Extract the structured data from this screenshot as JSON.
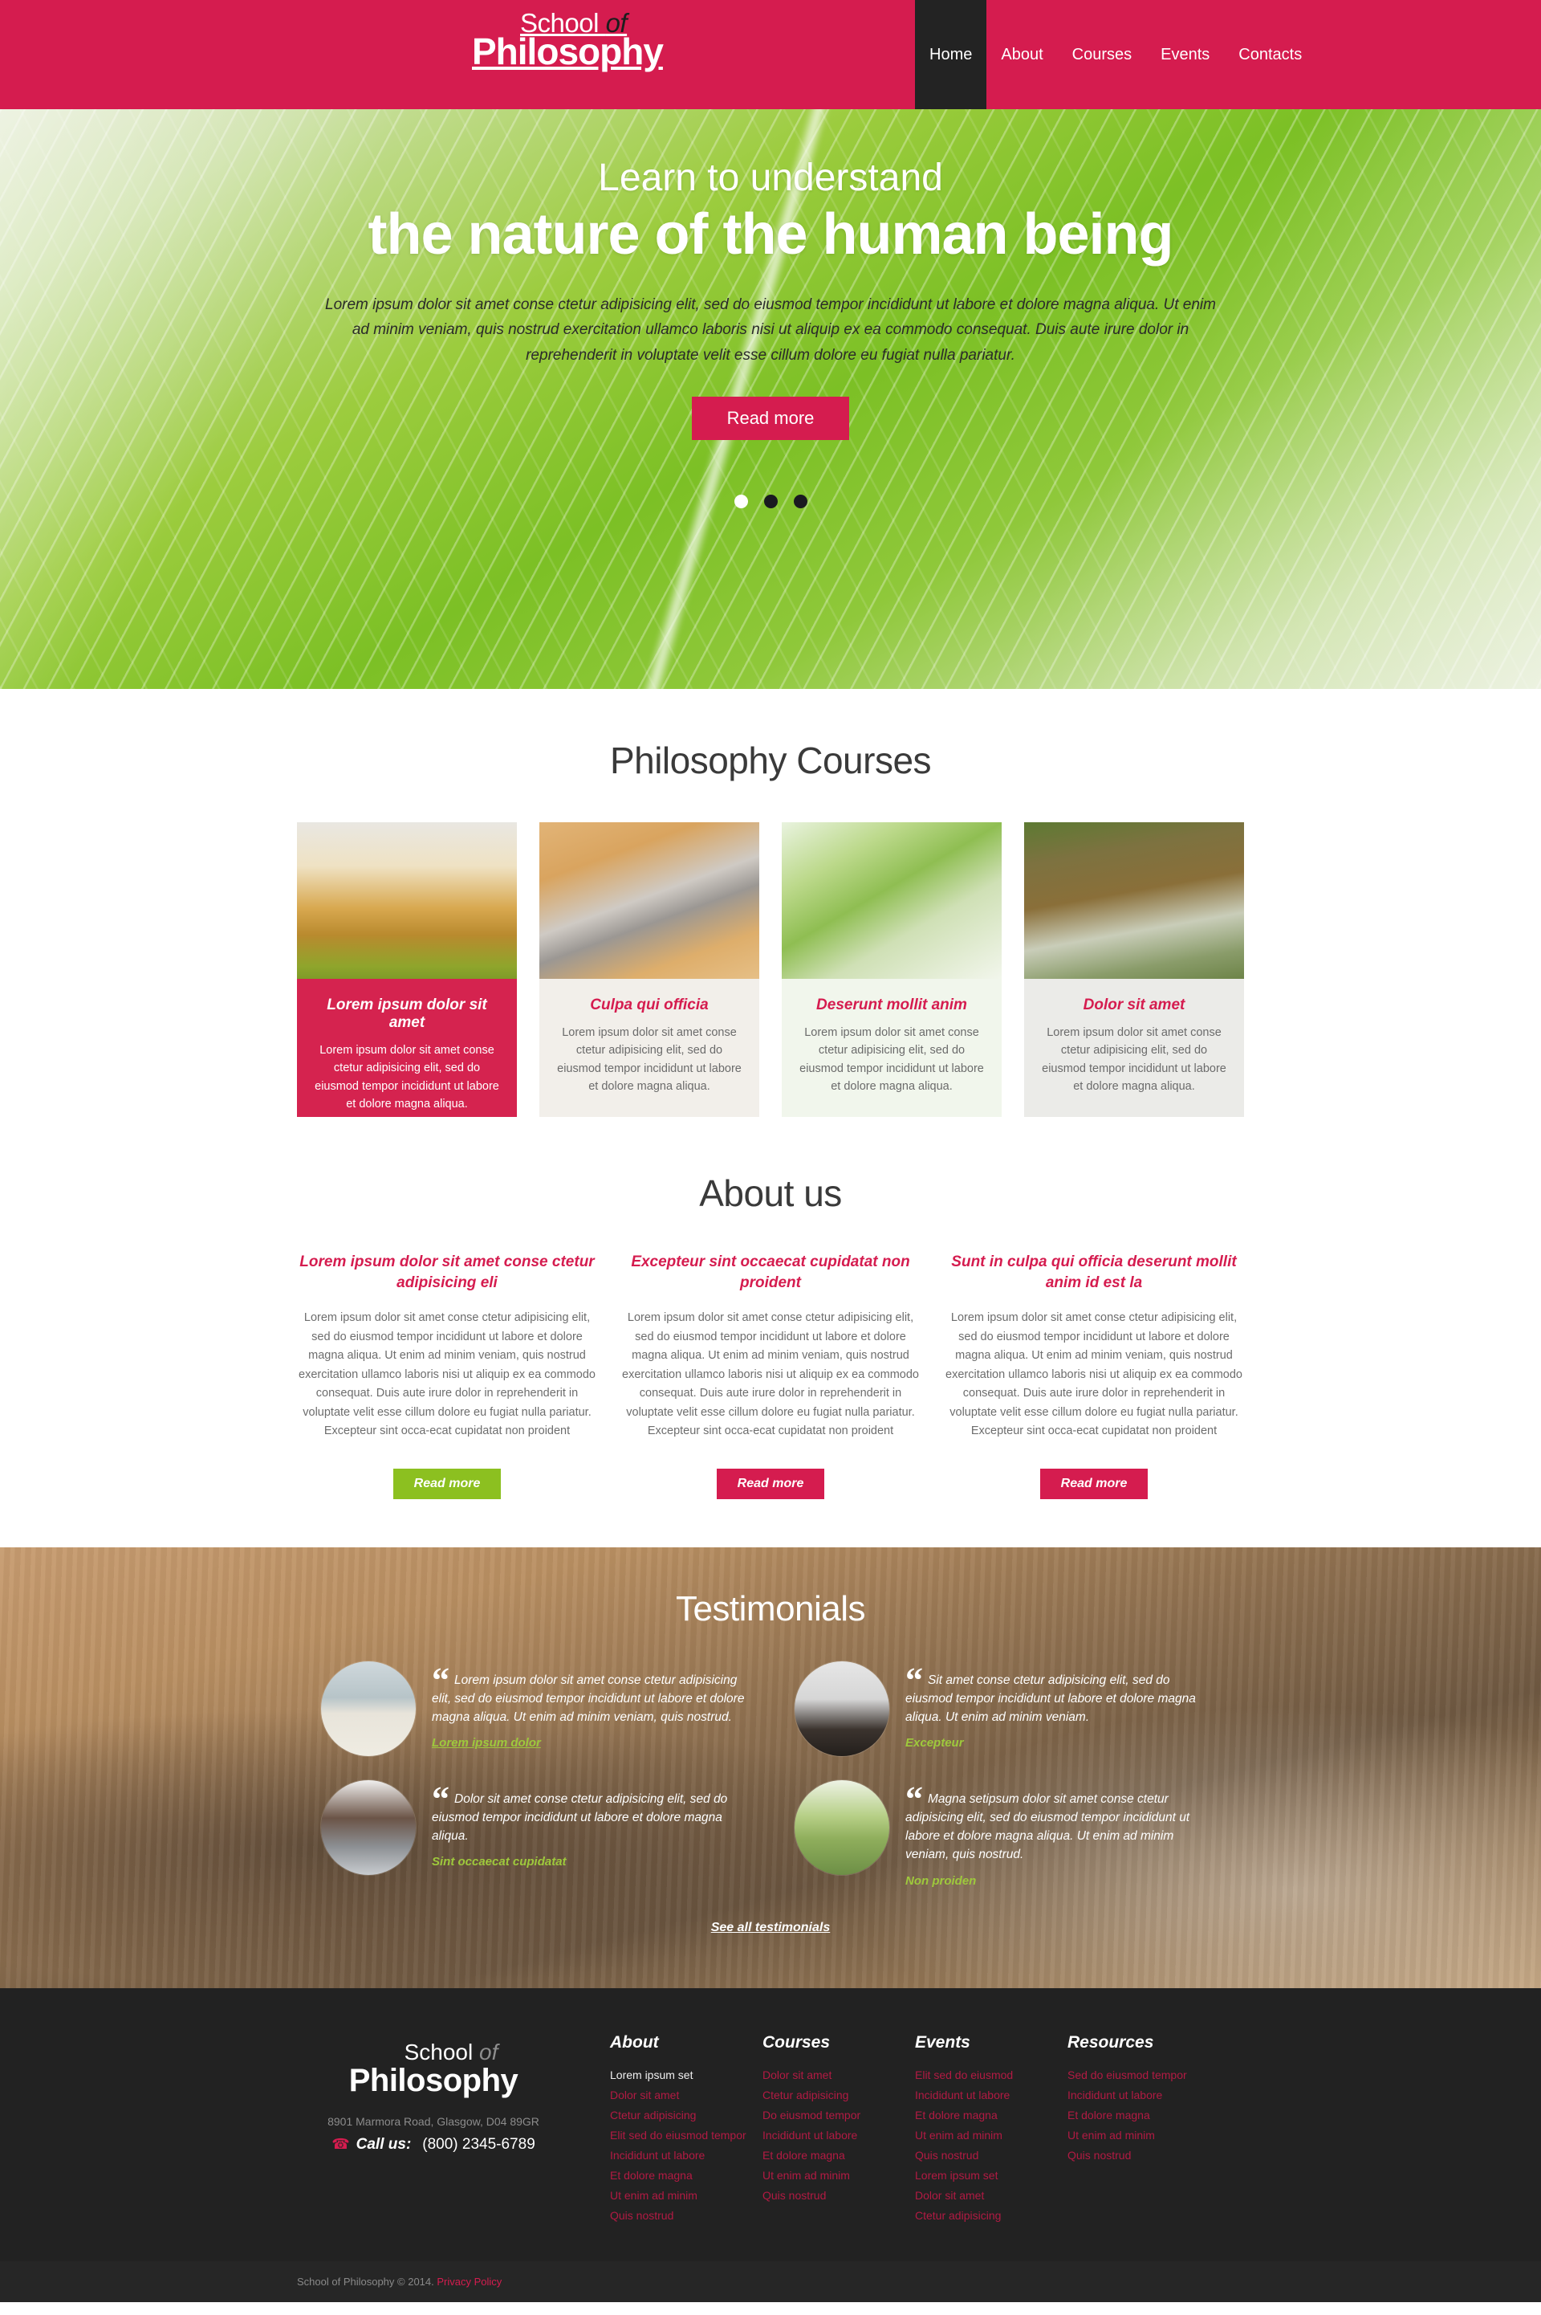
{
  "header": {
    "logo": {
      "line1_pre": "School ",
      "line1_em": "of",
      "line2": "Philosophy"
    },
    "nav": [
      {
        "label": "Home",
        "active": true
      },
      {
        "label": "About",
        "active": false
      },
      {
        "label": "Courses",
        "active": false
      },
      {
        "label": "Events",
        "active": false
      },
      {
        "label": "Contacts",
        "active": false
      }
    ]
  },
  "hero": {
    "kicker": "Learn to understand",
    "title": "the nature of the human being",
    "text": "Lorem ipsum dolor sit amet conse ctetur adipisicing elit, sed do eiusmod tempor incididunt ut labore et dolore magna aliqua. Ut enim ad minim veniam, quis nostrud exercitation ullamco laboris nisi ut aliquip ex ea commodo consequat. Duis aute irure dolor in reprehenderit in voluptate velit esse cillum dolore eu fugiat nulla pariatur.",
    "button": "Read more",
    "slides": [
      {
        "active": true
      },
      {
        "active": false
      },
      {
        "active": false
      }
    ]
  },
  "courses": {
    "title": "Philosophy Courses",
    "items": [
      {
        "heading": "Lorem ipsum dolor sit amet",
        "text": "Lorem ipsum dolor sit amet conse ctetur adipisicing elit, sed do eiusmod tempor incididunt ut labore et dolore magna aliqua.",
        "photo": "woman-arms-raised-field-photo"
      },
      {
        "heading": "Culpa qui officia",
        "text": "Lorem ipsum dolor sit amet conse ctetur adipisicing elit, sed do eiusmod tempor incididunt ut labore et dolore magna aliqua.",
        "photo": "zen-stones-sand-photo"
      },
      {
        "heading": "Deserunt mollit anim",
        "text": "Lorem ipsum dolor sit amet conse ctetur adipisicing elit, sed do eiusmod tempor incididunt ut labore et dolore magna aliqua.",
        "photo": "woman-stretching-forest-photo"
      },
      {
        "heading": "Dolor sit amet",
        "text": "Lorem ipsum dolor sit amet conse ctetur adipisicing elit, sed do eiusmod tempor incididunt ut labore et dolore magna aliqua.",
        "photo": "waterfall-rocks-photo"
      }
    ]
  },
  "about": {
    "title": "About us",
    "body": "Lorem ipsum dolor sit amet conse ctetur adipisicing elit, sed do eiusmod tempor incididunt ut labore et dolore magna aliqua. Ut enim ad minim veniam, quis nostrud exercitation ullamco laboris nisi ut aliquip ex ea commodo consequat. Duis aute irure dolor in reprehenderit in voluptate velit esse cillum dolore eu fugiat nulla pariatur. Excepteur sint occa-ecat cupidatat non proident",
    "columns": [
      {
        "heading": "Lorem ipsum dolor sit amet conse ctetur adipisicing eli",
        "button": "Read more",
        "button_color": "#8cc020"
      },
      {
        "heading": "Excepteur sint occaecat cupidatat non proident",
        "button": "Read more",
        "button_color": "#d51c4f"
      },
      {
        "heading": "Sunt in culpa qui officia deserunt mollit anim id est la",
        "button": "Read more",
        "button_color": "#d51c4f"
      }
    ]
  },
  "testimonials": {
    "title": "Testimonials",
    "see_all": "See all testimonials",
    "items": [
      {
        "quote": "Lorem ipsum dolor sit amet conse ctetur adipisicing elit, sed do eiusmod tempor incididunt ut labore et dolore magna aliqua. Ut enim ad minim veniam, quis nostrud.",
        "author": "Lorem ipsum dolor",
        "avatar": "woman-meditating-beach-avatar",
        "underlined": true
      },
      {
        "quote": "Sit amet conse ctetur adipisicing elit, sed do eiusmod tempor incididunt ut labore et dolore magna aliqua. Ut enim ad minim veniam.",
        "author": "Excepteur",
        "avatar": "man-curly-hair-avatar",
        "underlined": false
      },
      {
        "quote": "Dolor sit amet conse ctetur adipisicing elit, sed do eiusmod tempor incididunt ut labore et dolore magna aliqua.",
        "author": "Sint occaecat cupidatat",
        "avatar": "young-man-portrait-avatar",
        "underlined": false
      },
      {
        "quote": "Magna setipsum dolor sit amet conse ctetur adipisicing elit, sed do eiusmod tempor incididunt ut labore et dolore magna aliqua. Ut enim ad minim veniam, quis nostrud.",
        "author": "Non proiden",
        "avatar": "blonde-woman-dandelion-avatar",
        "underlined": false
      }
    ]
  },
  "footer": {
    "logo": {
      "line1_pre": "School ",
      "line1_em": "of",
      "line2": "Philosophy"
    },
    "address": "8901 Marmora Road,  Glasgow,  D04 89GR",
    "call_label": "Call us:",
    "phone": "(800) 2345-6789",
    "columns": [
      {
        "title": "About",
        "links": [
          {
            "label": "Lorem ipsum set",
            "plain": true
          },
          {
            "label": "Dolor sit amet",
            "plain": false
          },
          {
            "label": "Ctetur adipisicing",
            "plain": false
          },
          {
            "label": "Elit sed do eiusmod tempor",
            "plain": false
          },
          {
            "label": "Incididunt ut labore",
            "plain": false
          },
          {
            "label": "Et dolore magna",
            "plain": false
          },
          {
            "label": "Ut enim ad minim",
            "plain": false
          },
          {
            "label": "Quis nostrud",
            "plain": false
          }
        ]
      },
      {
        "title": "Courses",
        "links": [
          {
            "label": "Dolor sit amet",
            "plain": false
          },
          {
            "label": "Ctetur adipisicing",
            "plain": false
          },
          {
            "label": "Do eiusmod tempor",
            "plain": false
          },
          {
            "label": "Incididunt ut labore",
            "plain": false
          },
          {
            "label": "Et dolore magna",
            "plain": false
          },
          {
            "label": "Ut enim ad minim",
            "plain": false
          },
          {
            "label": "Quis nostrud",
            "plain": false
          }
        ]
      },
      {
        "title": "Events",
        "links": [
          {
            "label": "Elit sed do eiusmod",
            "plain": false
          },
          {
            "label": "Incididunt ut labore",
            "plain": false
          },
          {
            "label": "Et dolore magna",
            "plain": false
          },
          {
            "label": "Ut enim ad minim",
            "plain": false
          },
          {
            "label": "Quis nostrud",
            "plain": false
          },
          {
            "label": "Lorem ipsum set",
            "plain": false
          },
          {
            "label": "Dolor sit amet",
            "plain": false
          },
          {
            "label": "Ctetur adipisicing",
            "plain": false
          }
        ]
      },
      {
        "title": "Resources",
        "links": [
          {
            "label": "Sed do eiusmod tempor",
            "plain": false
          },
          {
            "label": "Incididunt ut labore",
            "plain": false
          },
          {
            "label": "Et dolore magna",
            "plain": false
          },
          {
            "label": "Ut enim ad minim",
            "plain": false
          },
          {
            "label": "Quis nostrud",
            "plain": false
          }
        ]
      }
    ]
  },
  "copyright": {
    "text": "School of Philosophy © 2014.",
    "link": "Privacy Policy"
  },
  "colors": {
    "brand": "#d51c4f",
    "green": "#8cc020",
    "dark": "#222222"
  }
}
